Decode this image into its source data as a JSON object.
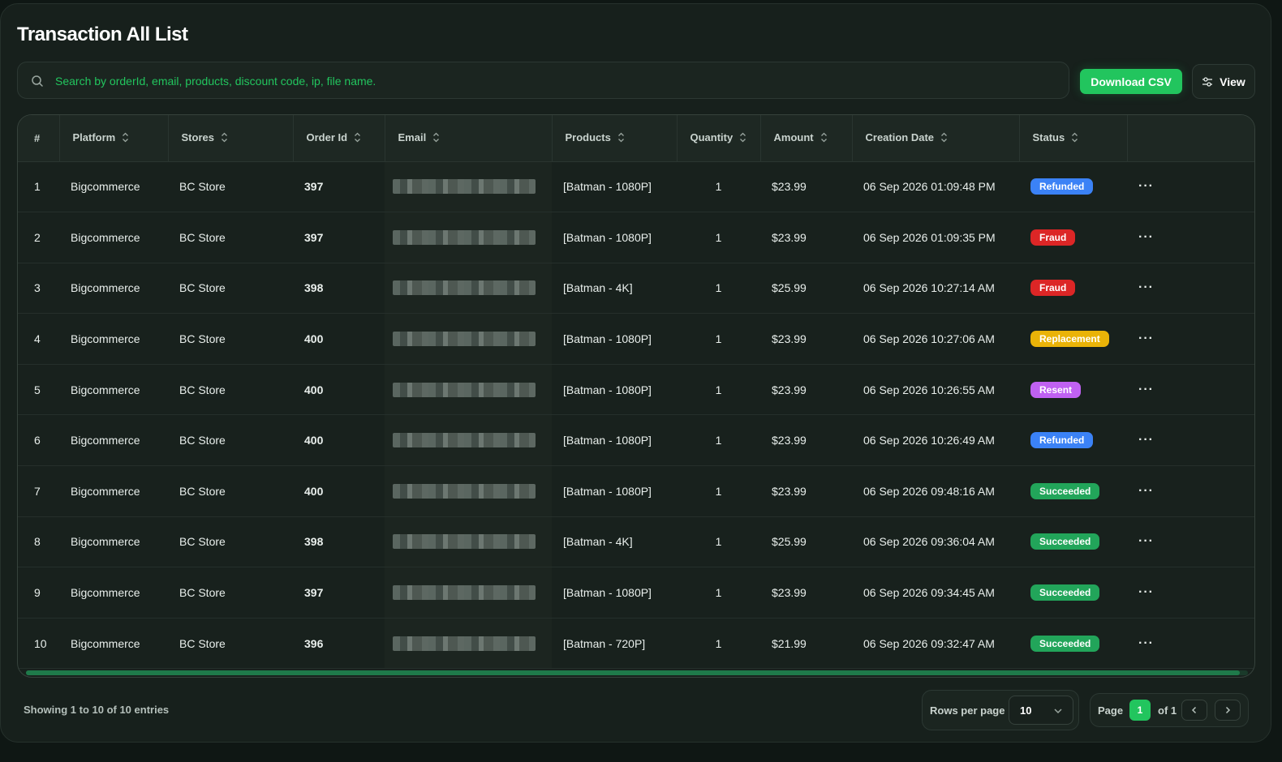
{
  "page": {
    "title": "Transaction All List"
  },
  "search": {
    "placeholder": "Search by orderId, email, products, discount code, ip, file name."
  },
  "toolbar": {
    "download_label": "Download CSV",
    "view_label": "View"
  },
  "table": {
    "columns": [
      "#",
      "Platform",
      "Stores",
      "Order Id",
      "Email",
      "Products",
      "Quantity",
      "Amount",
      "Creation Date",
      "Status"
    ],
    "rows": [
      {
        "num": "1",
        "platform": "Bigcommerce",
        "store": "BC Store",
        "order_id": "397",
        "product": "[Batman - 1080P]",
        "quantity": "1",
        "amount": "$23.99",
        "date": "06 Sep 2026 01:09:48 PM",
        "status": "Refunded",
        "status_color": "#3b82f6"
      },
      {
        "num": "2",
        "platform": "Bigcommerce",
        "store": "BC Store",
        "order_id": "397",
        "product": "[Batman - 1080P]",
        "quantity": "1",
        "amount": "$23.99",
        "date": "06 Sep 2026 01:09:35 PM",
        "status": "Fraud",
        "status_color": "#dc2626"
      },
      {
        "num": "3",
        "platform": "Bigcommerce",
        "store": "BC Store",
        "order_id": "398",
        "product": "[Batman - 4K]",
        "quantity": "1",
        "amount": "$25.99",
        "date": "06 Sep 2026 10:27:14 AM",
        "status": "Fraud",
        "status_color": "#dc2626"
      },
      {
        "num": "4",
        "platform": "Bigcommerce",
        "store": "BC Store",
        "order_id": "400",
        "product": "[Batman - 1080P]",
        "quantity": "1",
        "amount": "$23.99",
        "date": "06 Sep 2026 10:27:06 AM",
        "status": "Replacement",
        "status_color": "#eab308"
      },
      {
        "num": "5",
        "platform": "Bigcommerce",
        "store": "BC Store",
        "order_id": "400",
        "product": "[Batman - 1080P]",
        "quantity": "1",
        "amount": "$23.99",
        "date": "06 Sep 2026 10:26:55 AM",
        "status": "Resent",
        "status_color": "#c061f2"
      },
      {
        "num": "6",
        "platform": "Bigcommerce",
        "store": "BC Store",
        "order_id": "400",
        "product": "[Batman - 1080P]",
        "quantity": "1",
        "amount": "$23.99",
        "date": "06 Sep 2026 10:26:49 AM",
        "status": "Refunded",
        "status_color": "#3b82f6"
      },
      {
        "num": "7",
        "platform": "Bigcommerce",
        "store": "BC Store",
        "order_id": "400",
        "product": "[Batman - 1080P]",
        "quantity": "1",
        "amount": "$23.99",
        "date": "06 Sep 2026 09:48:16 AM",
        "status": "Succeeded",
        "status_color": "#22a55a"
      },
      {
        "num": "8",
        "platform": "Bigcommerce",
        "store": "BC Store",
        "order_id": "398",
        "product": "[Batman - 4K]",
        "quantity": "1",
        "amount": "$25.99",
        "date": "06 Sep 2026 09:36:04 AM",
        "status": "Succeeded",
        "status_color": "#22a55a"
      },
      {
        "num": "9",
        "platform": "Bigcommerce",
        "store": "BC Store",
        "order_id": "397",
        "product": "[Batman - 1080P]",
        "quantity": "1",
        "amount": "$23.99",
        "date": "06 Sep 2026 09:34:45 AM",
        "status": "Succeeded",
        "status_color": "#22a55a"
      },
      {
        "num": "10",
        "platform": "Bigcommerce",
        "store": "BC Store",
        "order_id": "396",
        "product": "[Batman - 720P]",
        "quantity": "1",
        "amount": "$21.99",
        "date": "06 Sep 2026 09:32:47 AM",
        "status": "Succeeded",
        "status_color": "#22a55a"
      }
    ],
    "row_action": "···"
  },
  "footer": {
    "entries_text": "Showing 1 to 10 of 10 entries",
    "rows_per_page_label": "Rows per page",
    "rows_per_page_value": "10",
    "page_label": "Page",
    "current_page": "1",
    "total_pages_text": "of 1"
  },
  "colors": {
    "accent": "#22c55e",
    "background": "#17201c"
  },
  "icons": {
    "search": "search-icon",
    "view": "sliders-icon",
    "sort": "sort-icon",
    "prev": "chevron-left-icon",
    "next": "chevron-right-icon",
    "dropdown": "chevron-down-icon"
  }
}
